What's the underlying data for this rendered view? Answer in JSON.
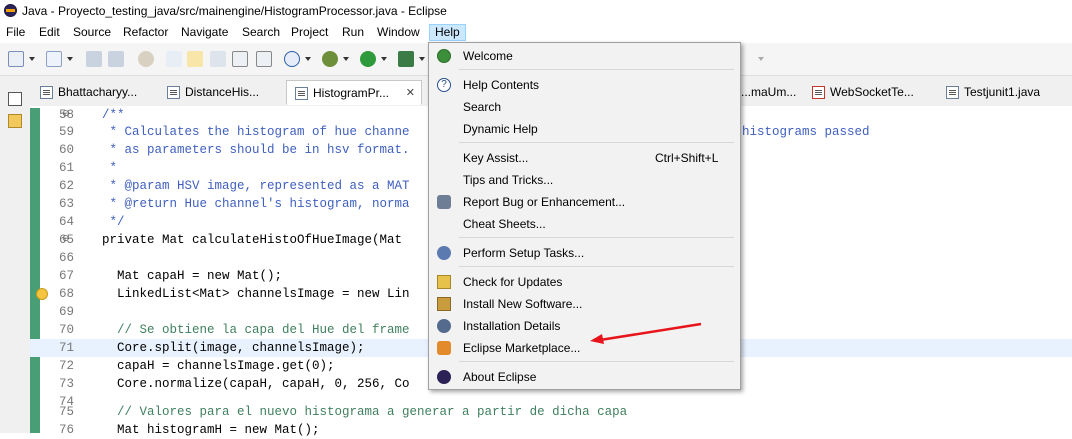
{
  "window": {
    "title": "Java - Proyecto_testing_java/src/mainengine/HistogramProcessor.java - Eclipse"
  },
  "menubar": [
    "File",
    "Edit",
    "Source",
    "Refactor",
    "Navigate",
    "Search",
    "Project",
    "Run",
    "Window",
    "Help"
  ],
  "tabs": [
    {
      "label": "Bhattacharyy..."
    },
    {
      "label": "DistanceHis..."
    },
    {
      "label": "HistogramPr...",
      "close": "✕"
    },
    {
      "label": "...maUm..."
    },
    {
      "label": "WebSocketTe..."
    },
    {
      "label": "Testjunit1.java"
    }
  ],
  "editor": {
    "lines": [
      {
        "n": "58",
        "code": "/**",
        "cls": "cmt",
        "fold": "⊖"
      },
      {
        "n": "59",
        "code": " * Calculates the histogram of hue channe",
        "tail": "histograms passed",
        "cls": "cmt"
      },
      {
        "n": "60",
        "code": " * as parameters should be in hsv format.",
        "cls": "cmt"
      },
      {
        "n": "61",
        "code": " *",
        "cls": "cmt"
      },
      {
        "n": "62",
        "code": " * @param HSV image, represented as a MAT",
        "cls": "cmt"
      },
      {
        "n": "63",
        "code": " * @return Hue channel's histogram, norma",
        "cls": "cmt"
      },
      {
        "n": "64",
        "code": " */",
        "cls": "cmt"
      },
      {
        "n": "65",
        "code": "private Mat calculateHistoOfHueImage(Mat",
        "cls": "",
        "fold": "⊖"
      },
      {
        "n": "66",
        "code": "",
        "cls": ""
      },
      {
        "n": "67",
        "code": "  Mat capaH = new Mat();",
        "cls": ""
      },
      {
        "n": "68",
        "code": "  LinkedList<Mat> channelsImage = new Lin",
        "cls": ""
      },
      {
        "n": "69",
        "code": "",
        "cls": ""
      },
      {
        "n": "70",
        "code": "  // Se obtiene la capa del Hue del frame",
        "cls": "scmt"
      },
      {
        "n": "71",
        "code": "  Core.split(image, channelsImage);",
        "cls": ""
      },
      {
        "n": "72",
        "code": "  capaH = channelsImage.get(0);",
        "cls": ""
      },
      {
        "n": "73",
        "code": "  Core.normalize(capaH, capaH, 0, 256, Co",
        "cls": ""
      },
      {
        "n": "74",
        "code": "",
        "cls": ""
      },
      {
        "n": "75",
        "code": "  // Valores para el nuevo histograma a generar a partir de dicha capa",
        "cls": "scmt"
      },
      {
        "n": "76",
        "code": "  Mat histogramH = new Mat();",
        "cls": ""
      }
    ]
  },
  "help_menu": {
    "items": [
      {
        "label": "Welcome",
        "icon": "welcome-icon"
      },
      {
        "label": "Help Contents",
        "icon": "help-contents-icon"
      },
      {
        "label": "Search",
        "icon": ""
      },
      {
        "label": "Dynamic Help",
        "icon": ""
      },
      {
        "label": "Key Assist...",
        "shortcut": "Ctrl+Shift+L",
        "icon": ""
      },
      {
        "label": "Tips and Tricks...",
        "icon": ""
      },
      {
        "label": "Report Bug or Enhancement...",
        "icon": "bug-icon"
      },
      {
        "label": "Cheat Sheets...",
        "icon": ""
      },
      {
        "label": "Perform Setup Tasks...",
        "icon": "setup-icon"
      },
      {
        "label": "Check for Updates",
        "icon": "update-icon"
      },
      {
        "label": "Install New Software...",
        "icon": "install-icon"
      },
      {
        "label": "Installation Details",
        "icon": "installation-details-icon"
      },
      {
        "label": "Eclipse Marketplace...",
        "icon": "marketplace-icon"
      },
      {
        "label": "About Eclipse",
        "icon": "eclipse-icon"
      }
    ]
  },
  "colors": {
    "menu_highlight": "#cce8ff",
    "annotation_arrow": "#e8141b",
    "change_bar": "#4a9e76"
  }
}
